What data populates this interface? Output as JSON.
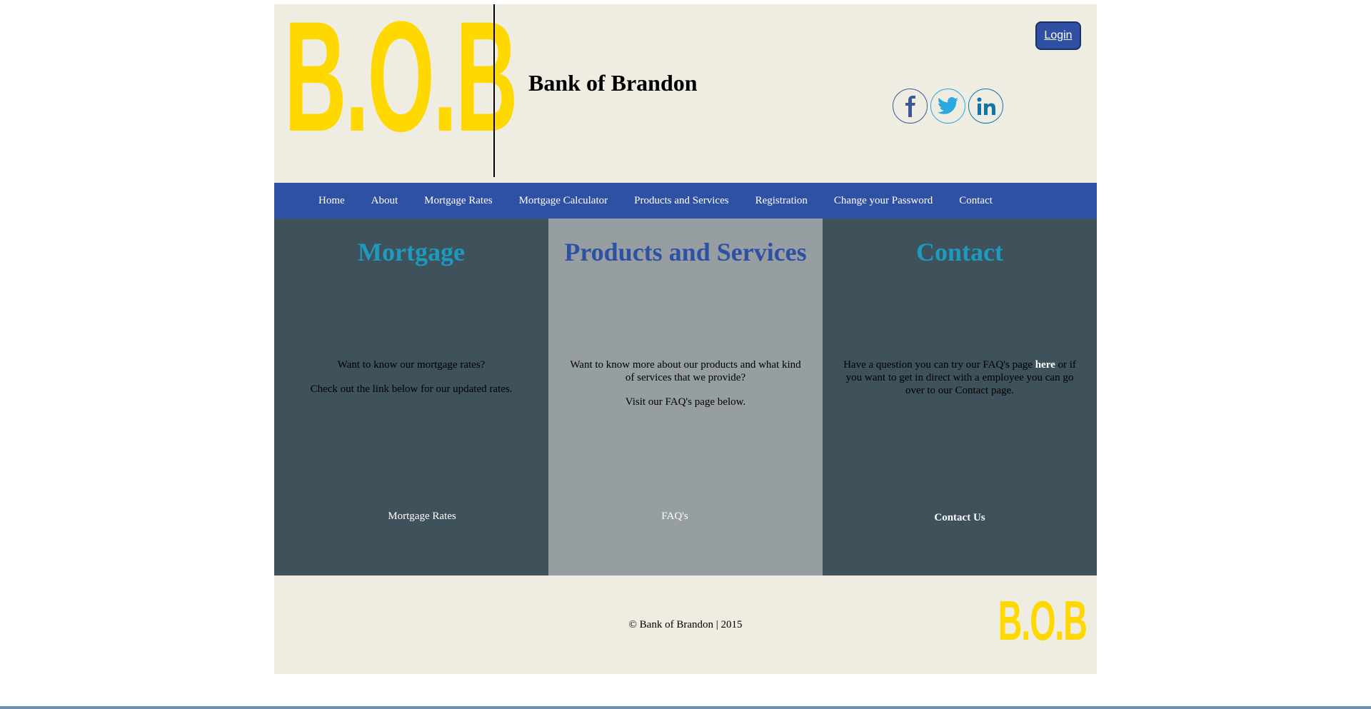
{
  "header": {
    "logo_text": "B.O.B",
    "title": "Bank of Brandon",
    "login_label": "Login",
    "social": [
      "facebook-icon",
      "twitter-icon",
      "linkedin-icon"
    ]
  },
  "nav": {
    "items": [
      {
        "label": "Home"
      },
      {
        "label": "About"
      },
      {
        "label": "Mortgage Rates"
      },
      {
        "label": "Mortgage Calculator"
      },
      {
        "label": "Products and Services"
      },
      {
        "label": "Registration"
      },
      {
        "label": "Change your Password"
      },
      {
        "label": "Contact"
      }
    ]
  },
  "panels": {
    "mortgage": {
      "title": "Mortgage",
      "line1": "Want to know our mortgage rates?",
      "line2": "Check out the link below for our updated rates.",
      "link": "Mortgage Rates"
    },
    "products": {
      "title": "Products and Services",
      "line1": "Want to know more about our products and what kind of services that we provide?",
      "line2": "Visit our FAQ's page below.",
      "link": "FAQ's"
    },
    "contact": {
      "title": "Contact",
      "text_before": "Have a question you can try our FAQ's page ",
      "here": "here",
      "text_after": " or if you want to get in direct with a employee you can go over to our Contact page.",
      "link": "Contact Us"
    }
  },
  "footer": {
    "copyright": "© Bank of Brandon | 2015",
    "logo_text": "B.O.B"
  },
  "colors": {
    "logo_yellow": "#ffd800",
    "nav_blue": "#2f51a3",
    "panel_dark": "#3f515a",
    "panel_light": "#969ea2",
    "heading_teal": "#1d9abf",
    "cream": "#efece2"
  }
}
